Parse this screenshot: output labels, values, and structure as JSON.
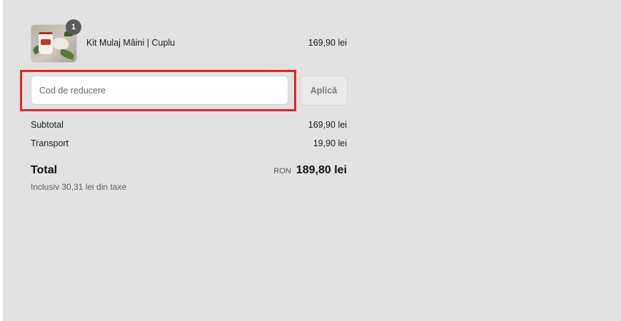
{
  "cart": {
    "item": {
      "name": "Kit Mulaj Mâini | Cuplu",
      "price": "169,90 lei",
      "quantity": "1"
    }
  },
  "discount": {
    "placeholder": "Cod de reducere",
    "value": "",
    "apply_label": "Aplică"
  },
  "summary": {
    "subtotal_label": "Subtotal",
    "subtotal_value": "169,90 lei",
    "shipping_label": "Transport",
    "shipping_value": "19,90 lei",
    "total_label": "Total",
    "currency": "RON",
    "total_value": "189,80 lei",
    "tax_note": "Inclusiv 30,31 lei din taxe"
  },
  "colors": {
    "panel_background": "#e2e2e2",
    "highlight_border": "#e0262d",
    "badge_background": "#5a5a5a"
  }
}
